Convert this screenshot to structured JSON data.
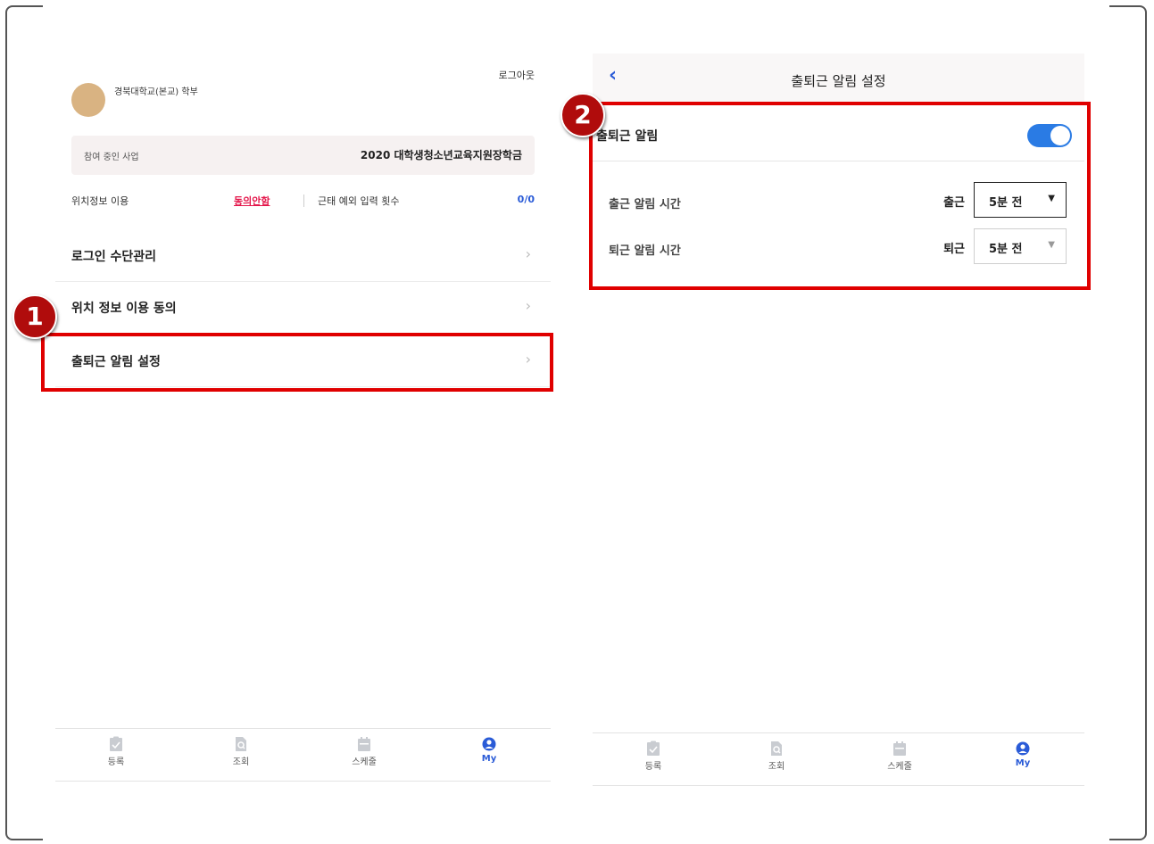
{
  "left_screen": {
    "logout_label": "로그아웃",
    "school_name": "경북대학교(본교) 학부",
    "project": {
      "label": "참여 중인 사업",
      "value": "2020 대학생청소년교육지원장학금"
    },
    "location": {
      "label": "위치정보 이용",
      "status": "동의안함"
    },
    "exceptions": {
      "label": "근태 예외 입력 횟수",
      "count": "0/0"
    },
    "menu": [
      {
        "label": "로그인 수단관리"
      },
      {
        "label": "위치 정보 이용 동의"
      },
      {
        "label": "출퇴근 알림 설정"
      }
    ]
  },
  "right_screen": {
    "title": "출퇴근 알림 설정",
    "toggle_label": "출퇴근 알림",
    "toggle_on": true,
    "rows": [
      {
        "label": "출근 알림 시간",
        "prefix": "출근",
        "selected": "5분 전"
      },
      {
        "label": "퇴근 알림 시간",
        "prefix": "퇴근",
        "selected": "5분 전"
      }
    ]
  },
  "tabbar": [
    {
      "label": "등록",
      "icon": "clipboard-check-icon"
    },
    {
      "label": "조회",
      "icon": "document-search-icon"
    },
    {
      "label": "스케줄",
      "icon": "calendar-icon"
    },
    {
      "label": "My",
      "icon": "user-circle-icon"
    }
  ],
  "annotations": {
    "badge_1": "1",
    "badge_2": "2"
  },
  "colors": {
    "accent": "#2a5bd7",
    "toggle": "#2a7be4",
    "alert": "#e4174b",
    "highlight": "#e00000"
  }
}
